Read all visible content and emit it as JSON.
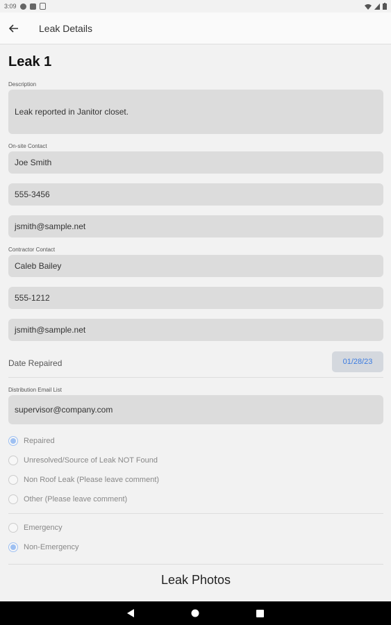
{
  "status_bar": {
    "time": "3:09"
  },
  "app_bar": {
    "title": "Leak Details"
  },
  "leak": {
    "title": "Leak 1",
    "description_label": "Description",
    "description": "Leak reported in Janitor closet.",
    "onsite_label": "On-site Contact",
    "onsite_name": "Joe Smith",
    "onsite_phone": "555-3456",
    "onsite_email": "jsmith@sample.net",
    "contractor_label": "Contractor Contact",
    "contractor_name": "Caleb Bailey",
    "contractor_phone": "555-1212",
    "contractor_email": "jsmith@sample.net",
    "date_label": "Date Repaired",
    "date_value": "01/28/23",
    "distribution_label": "Distribution Email List",
    "distribution_email": "supervisor@company.com"
  },
  "status_options": [
    {
      "label": "Repaired",
      "selected": true
    },
    {
      "label": "Unresolved/Source of Leak NOT Found",
      "selected": false
    },
    {
      "label": "Non Roof Leak (Please leave comment)",
      "selected": false
    },
    {
      "label": "Other (Please leave comment)",
      "selected": false
    }
  ],
  "priority_options": [
    {
      "label": "Emergency",
      "selected": false
    },
    {
      "label": "Non-Emergency",
      "selected": true
    }
  ],
  "photos": {
    "title": "Leak Photos"
  },
  "colors": {
    "accent": "#3b7be0",
    "radio_selected": "#9ec0f2",
    "field_bg": "#dcdcdc"
  }
}
